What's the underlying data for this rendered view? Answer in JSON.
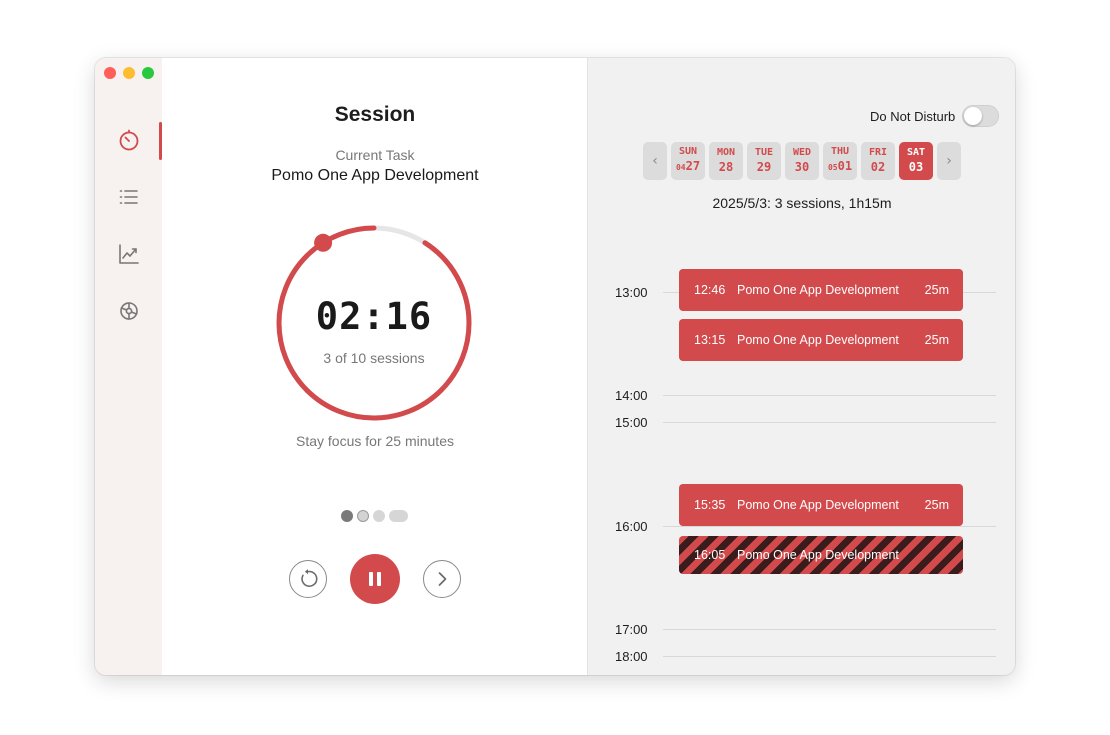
{
  "window": {
    "title": "Session"
  },
  "sidebar": {
    "items": [
      {
        "name": "timer",
        "icon": "timer-icon",
        "active": true
      },
      {
        "name": "tasks",
        "icon": "list-icon",
        "active": false
      },
      {
        "name": "stats",
        "icon": "chart-line-icon",
        "active": false
      },
      {
        "name": "settings",
        "icon": "gear-icon",
        "active": false
      }
    ]
  },
  "session": {
    "title": "Session",
    "task_caption": "Current Task",
    "task_name": "Pomo One App Development",
    "timer": "02:16",
    "sessions_text": "3 of 10 sessions",
    "focus_text": "Stay focus for 25 minutes",
    "progress": 0.91,
    "dots": [
      "done",
      "current",
      "todo",
      "long"
    ],
    "controls": {
      "reset": "reset-icon",
      "pause": "pause-icon",
      "skip": "chevron-right-icon"
    }
  },
  "calendar": {
    "dnd_label": "Do Not Disturb",
    "dnd_on": false,
    "days": [
      {
        "dow": "SUN",
        "prefix": "04",
        "dom": "27",
        "selected": false
      },
      {
        "dow": "MON",
        "prefix": "",
        "dom": "28",
        "selected": false
      },
      {
        "dow": "TUE",
        "prefix": "",
        "dom": "29",
        "selected": false
      },
      {
        "dow": "WED",
        "prefix": "",
        "dom": "30",
        "selected": false
      },
      {
        "dow": "THU",
        "prefix": "05",
        "dom": "01",
        "selected": false
      },
      {
        "dow": "FRI",
        "prefix": "",
        "dom": "02",
        "selected": false
      },
      {
        "dow": "SAT",
        "prefix": "",
        "dom": "03",
        "selected": true
      }
    ],
    "summary": "2025/5/3: 3 sessions, 1h15m",
    "hours": [
      "13:00",
      "14:00",
      "15:00",
      "16:00",
      "17:00",
      "18:00"
    ],
    "events": [
      {
        "time": "12:46",
        "title": "Pomo One App Development",
        "duration": "25m",
        "running": false
      },
      {
        "time": "13:15",
        "title": "Pomo One App Development",
        "duration": "25m",
        "running": false
      },
      {
        "time": "15:35",
        "title": "Pomo One App Development",
        "duration": "25m",
        "running": false
      },
      {
        "time": "16:05",
        "title": "Pomo One App Development",
        "duration": "",
        "running": true
      }
    ]
  },
  "colors": {
    "accent": "#d24a4c",
    "track": "#e6e6e6"
  }
}
